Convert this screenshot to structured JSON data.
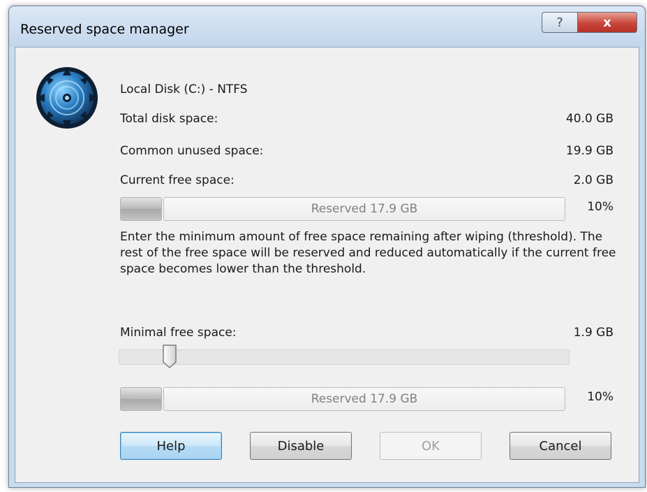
{
  "window": {
    "title": "Reserved space manager",
    "help_glyph": "?",
    "close_glyph": "x"
  },
  "disk": {
    "name": "Local Disk (C:) - NTFS",
    "total_label": "Total disk space:",
    "total_value": "40.0 GB",
    "unused_label": "Common unused space:",
    "unused_value": "19.9 GB",
    "free_label": "Current free space:",
    "free_value": "2.0 GB"
  },
  "current_bar": {
    "reserved_text": "Reserved 17.9 GB",
    "percent": "10%"
  },
  "description": "Enter the minimum amount of free space remaining after wiping (threshold). The rest of the free space will be reserved and reduced automatically if the current free space becomes lower than the threshold.",
  "threshold": {
    "label": "Minimal free space:",
    "value": "1.9 GB"
  },
  "slider": {
    "level": 0.1
  },
  "threshold_bar": {
    "reserved_text": "Reserved 17.9 GB",
    "percent": "10%"
  },
  "buttons": {
    "help": "Help",
    "disable": "Disable",
    "ok": "OK",
    "cancel": "Cancel"
  },
  "icons": {
    "app": "disk-gear-icon"
  },
  "colors": {
    "accent": "#3c7fb1",
    "close": "#c9463a"
  }
}
